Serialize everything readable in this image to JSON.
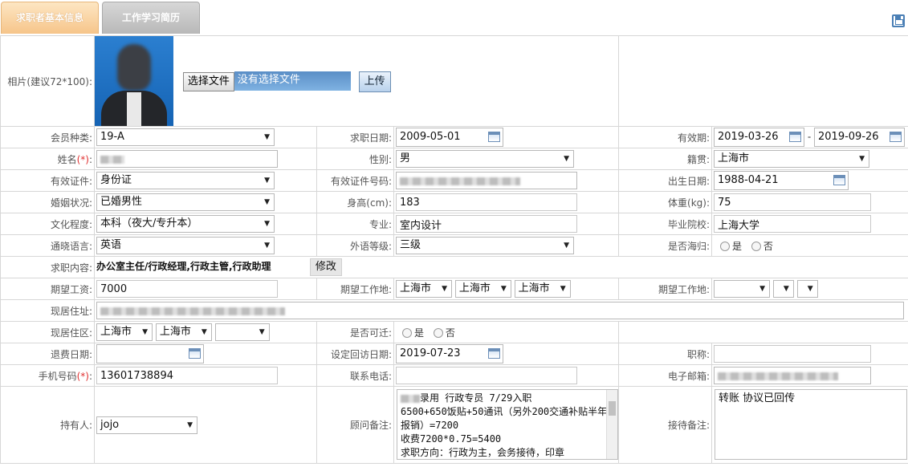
{
  "tabs": [
    {
      "label": "求职者基本信息"
    },
    {
      "label": "工作学习简历"
    }
  ],
  "photo": {
    "label": "相片(建议72*100):",
    "choose_file": "选择文件",
    "no_file": "没有选择文件",
    "upload": "上传"
  },
  "labels": {
    "member_type": "会员种类:",
    "apply_date": "求职日期:",
    "valid_period": "有效期:",
    "name": "姓名",
    "gender": "性别:",
    "native": "籍贯:",
    "id_type": "有效证件:",
    "id_no": "有效证件号码:",
    "birth": "出生日期:",
    "marital": "婚姻状况:",
    "height": "身高(cm):",
    "weight": "体重(kg):",
    "education": "文化程度:",
    "major": "专业:",
    "school": "毕业院校:",
    "language": "通晓语言:",
    "foreign_level": "外语等级:",
    "returnee": "是否海归:",
    "job_intent": "求职内容:",
    "salary": "期望工资:",
    "work_place": "期望工作地:",
    "work_place2": "期望工作地:",
    "address": "现居住址:",
    "district": "现居住区:",
    "relocate": "是否可迁:",
    "refund_date": "退费日期:",
    "visit_date": "设定回访日期:",
    "title": "职称:",
    "mobile": "手机号码",
    "phone": "联系电话:",
    "email": "电子邮箱:",
    "holder": "持有人:",
    "consultant_note": "顾问备注:",
    "reception_note": "接待备注:",
    "req_mark": "(*)",
    "colon": ":",
    "yes": "是",
    "no": "否",
    "dash": "-"
  },
  "values": {
    "member_type": "19-A",
    "apply_date": "2009-05-01",
    "valid_from": "2019-03-26",
    "valid_to": "2019-09-26",
    "gender": "男",
    "native": "上海市",
    "id_type": "身份证",
    "birth": "1988-04-21",
    "marital": "已婚男性",
    "height": "183",
    "weight": "75",
    "education": "本科（夜大/专升本）",
    "major": "室内设计",
    "school": "上海大学",
    "language": "英语",
    "foreign_level": "三级",
    "job_intent": "办公室主任/行政经理,行政主管,行政助理",
    "modify": "修改",
    "salary": "7000",
    "work_place": [
      "上海市",
      "上海市",
      "上海市"
    ],
    "district": [
      "上海市",
      "上海市"
    ],
    "visit_date": "2019-07-23",
    "mobile": "13601738894",
    "holder": "jojo",
    "consultant_note": "录用 行政专员 7/29入职\n6500+650饭贴+50通讯（另外200交通补贴半年报销）=7200\n收费7200*0.75=5400\n求职方向：行政为主，会务接待，印章",
    "reception_note": "转账 协议已回传"
  }
}
